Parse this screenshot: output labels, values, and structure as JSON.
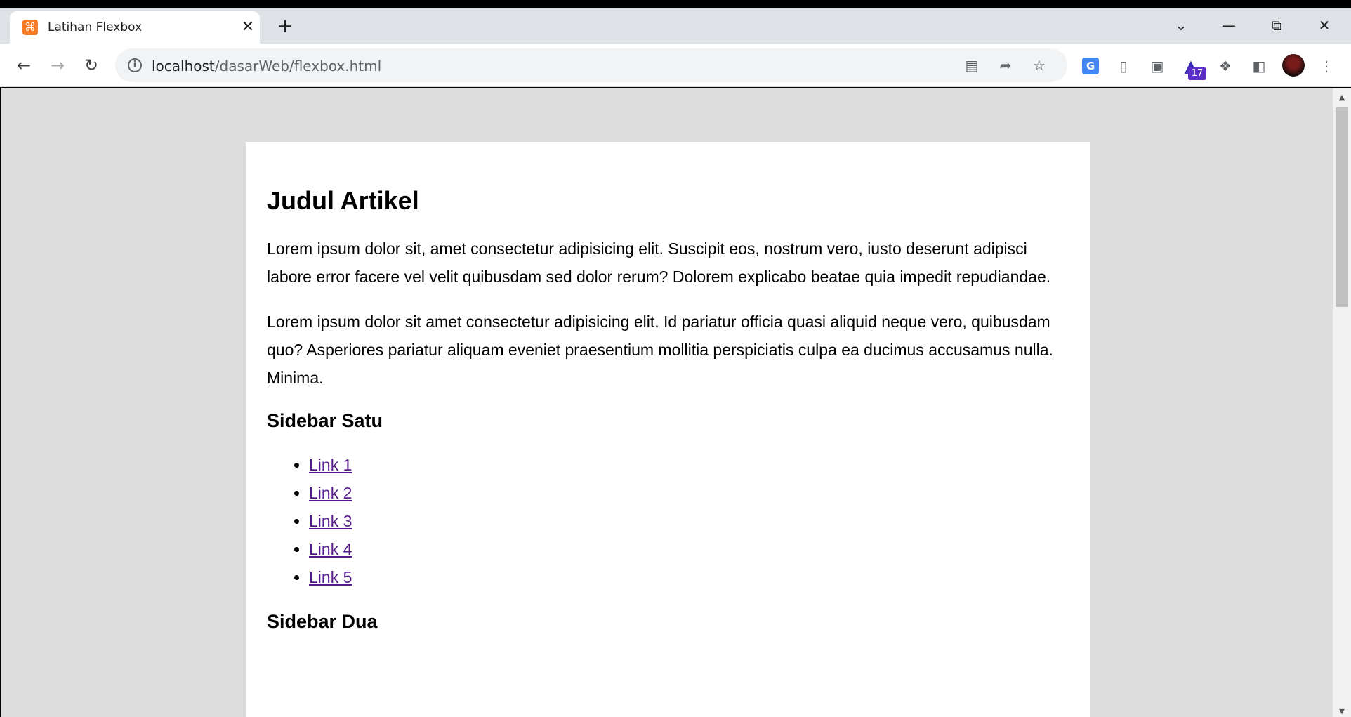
{
  "browser": {
    "tab_title": "Latihan Flexbox",
    "tab_close": "✕",
    "new_tab": "+",
    "url_host": "localhost",
    "url_path": "/dasarWeb/flexbox.html",
    "extension_badge": "17"
  },
  "page": {
    "title": "Judul Artikel",
    "paragraphs": [
      "Lorem ipsum dolor sit, amet consectetur adipisicing elit. Suscipit eos, nostrum vero, iusto deserunt adipisci labore error facere vel velit quibusdam sed dolor rerum? Dolorem explicabo beatae quia impedit repudiandae.",
      "Lorem ipsum dolor sit amet consectetur adipisicing elit. Id pariatur officia quasi aliquid neque vero, quibusdam quo? Asperiores pariatur aliquam eveniet praesentium mollitia perspiciatis culpa ea ducimus accusamus nulla. Minima."
    ],
    "sidebar_satu": {
      "title": "Sidebar Satu",
      "links": [
        "Link 1",
        "Link 2",
        "Link 3",
        "Link 4",
        "Link 5"
      ]
    },
    "sidebar_dua": {
      "title": "Sidebar Dua"
    }
  },
  "colors": {
    "page_background": "#dddddd",
    "link_visited": "#551a8b",
    "favicon": "#fb7a24"
  }
}
